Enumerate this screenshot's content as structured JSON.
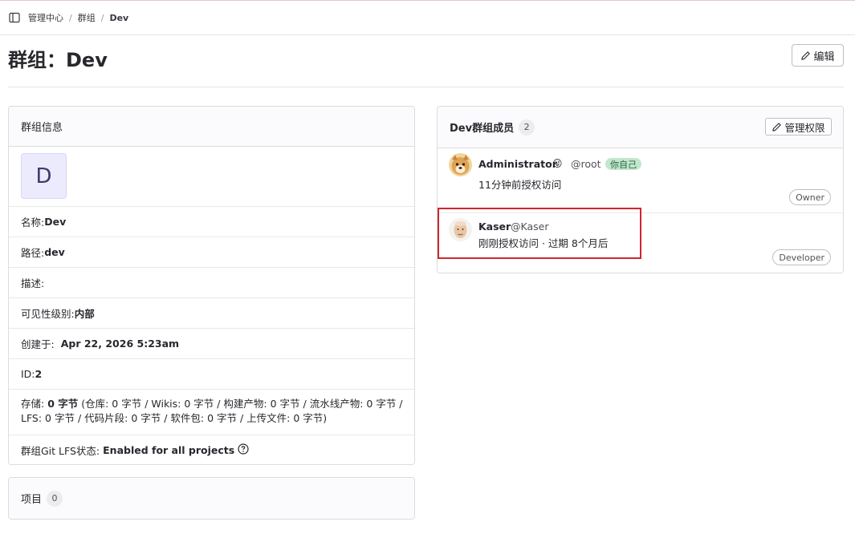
{
  "breadcrumb": {
    "items": [
      "管理中心",
      "群组",
      "Dev"
    ],
    "separator": "/"
  },
  "page": {
    "title": "群组：Dev",
    "edit_label": "编辑"
  },
  "info": {
    "header": "群组信息",
    "avatar_letter": "D",
    "name_label": "名称: ",
    "name_value": "Dev",
    "path_label": "路径: ",
    "path_value": "dev",
    "desc_label": "描述:",
    "visibility_label": "可见性级别: ",
    "visibility_value": "内部",
    "created_label": "创建于: ",
    "created_value": "Apr 22, 2026 5:23am",
    "id_label": "ID: ",
    "id_value": "2",
    "storage_label": "存储: ",
    "storage_value": "0 字节",
    "storage_detail": "(仓库: 0 字节 / Wikis: 0 字节 / 构建产物: 0 字节 / 流水线产物: 0 字节 / LFS: 0 字节 / 代码片段: 0 字节 / 软件包: 0 字节 / 上传文件: 0 字节)",
    "lfs_label": "群组Git LFS状态: ",
    "lfs_value": "Enabled for all projects"
  },
  "projects": {
    "label": "项目",
    "count": "0"
  },
  "members": {
    "title": "Dev群组成员",
    "count": "2",
    "manage_label": "管理权限",
    "list": [
      {
        "name": "Administrator",
        "emoji": "😜",
        "username": "@root",
        "you_badge": "你自己",
        "access": "11分钟前授权访问",
        "role": "Owner"
      },
      {
        "name": "Kaser",
        "username": "@Kaser",
        "access": "刚刚授权访问 · 过期 8个月后",
        "role": "Developer"
      }
    ]
  },
  "colors": {
    "highlight": "#d0262c",
    "you_badge_bg": "#c3e6cd",
    "avatar_bg": "#eceafd"
  }
}
